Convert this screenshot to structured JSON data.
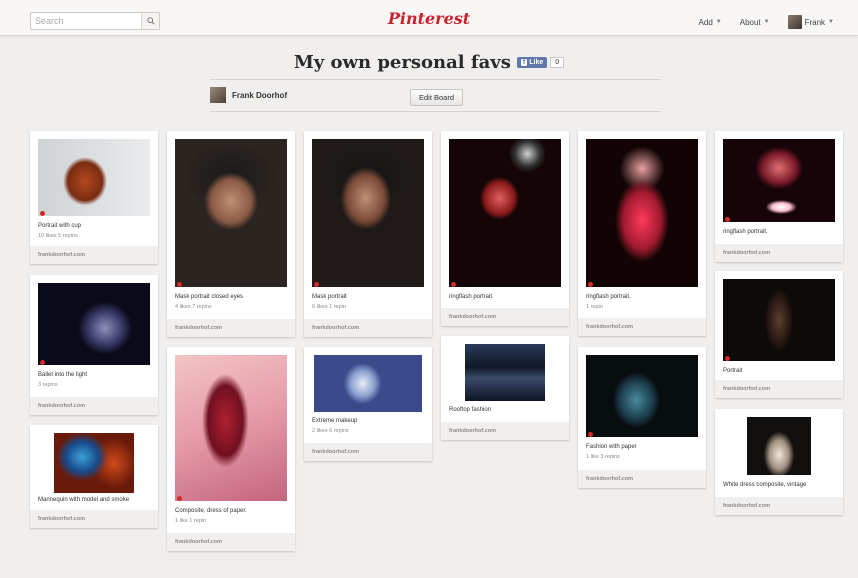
{
  "topbar": {
    "search_placeholder": "Search",
    "logo": "Pinterest",
    "nav": {
      "add": "Add",
      "about": "About",
      "user": "Frank"
    }
  },
  "board": {
    "title": "My own personal favs",
    "fb_like": "Like",
    "fb_count": "0",
    "owner": "Frank Doorhof",
    "edit_label": "Edit Board"
  },
  "pins": [
    {
      "caption": "Portrait with cup",
      "stats": "10 likes   5 repins",
      "source": "frankdoorhof.com"
    },
    {
      "caption": "Ballet into the light",
      "stats": "3 repins",
      "source": "frankdoorhof.com"
    },
    {
      "caption": "Mannequin with model and smoke",
      "stats": "",
      "source": "frankdoorhof.com"
    },
    {
      "caption": "Mask portrait closed eyes",
      "stats": "4 likes   7 repins",
      "source": "frankdoorhof.com"
    },
    {
      "caption": "Composite, dress of paper.",
      "stats": "1 like   1 repin",
      "source": "frankdoorhof.com"
    },
    {
      "caption": "Mask portrait",
      "stats": "6 likes   1 repin",
      "source": "frankdoorhof.com"
    },
    {
      "caption": "Extreme makeup",
      "stats": "2 likes   6 repins",
      "source": "frankdoorhof.com"
    },
    {
      "caption": "ringflash portrait.",
      "stats": "",
      "source": "frankdoorhof.com"
    },
    {
      "caption": "Rooftop fashion",
      "stats": "",
      "source": "frankdoorhof.com"
    },
    {
      "caption": "ringflash portrait.",
      "stats": "1 repin",
      "source": "frankdoorhof.com"
    },
    {
      "caption": "Fashion with paper",
      "stats": "1 like   3 repins",
      "source": "frankdoorhof.com"
    },
    {
      "caption": "ringflash portrait.",
      "stats": "",
      "source": "frankdoorhof.com"
    },
    {
      "caption": "Portrait",
      "stats": "",
      "source": "frankdoorhof.com"
    },
    {
      "caption": "White dress composite, vintage",
      "stats": "",
      "source": "frankdoorhof.com"
    }
  ]
}
